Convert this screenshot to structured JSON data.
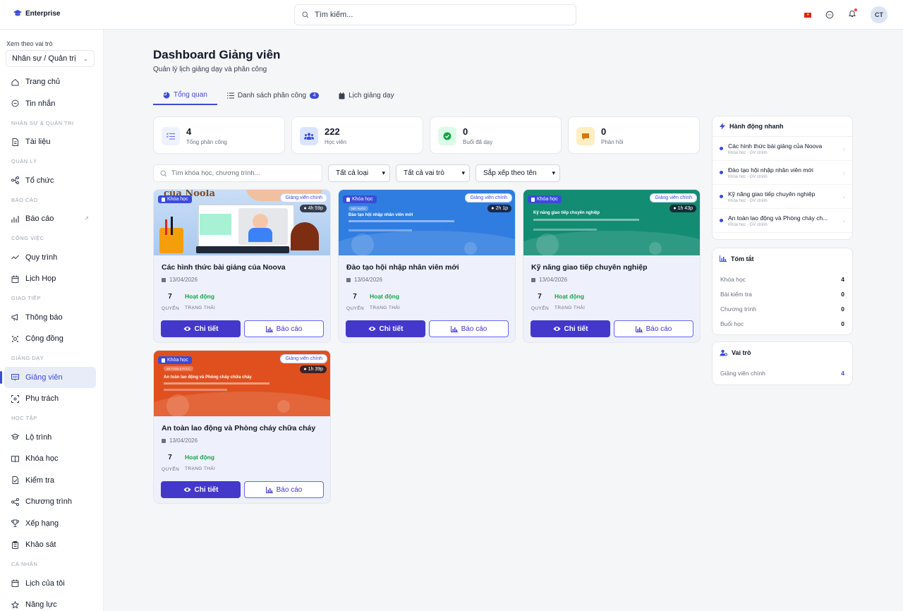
{
  "app": {
    "name": "Enterprise"
  },
  "header": {
    "search_placeholder": "Tìm kiếm...",
    "avatar": "CT"
  },
  "sidebar": {
    "view_as_label": "Xem theo vai trò",
    "role_value": "Nhân sự / Quản trị",
    "items": [
      {
        "type": "item",
        "label": "Trang chủ",
        "icon": "home-icon"
      },
      {
        "type": "item",
        "label": "Tin nhắn",
        "icon": "chat-icon"
      },
      {
        "type": "section",
        "label": "NHÂN SỰ & QUẢN TRỊ"
      },
      {
        "type": "item",
        "label": "Tài liệu",
        "icon": "document-icon"
      },
      {
        "type": "section",
        "label": "QUẢN LÝ"
      },
      {
        "type": "item",
        "label": "Tổ chức",
        "icon": "org-icon"
      },
      {
        "type": "section",
        "label": "BÁO CÁO"
      },
      {
        "type": "item",
        "label": "Báo cáo",
        "icon": "chart-icon",
        "external": true
      },
      {
        "type": "section",
        "label": "CÔNG VIỆC"
      },
      {
        "type": "item",
        "label": "Quy trình",
        "icon": "workflow-icon"
      },
      {
        "type": "item",
        "label": "Lịch Họp",
        "icon": "calendar-icon"
      },
      {
        "type": "section",
        "label": "GIAO TIẾP"
      },
      {
        "type": "item",
        "label": "Thông báo",
        "icon": "megaphone-icon"
      },
      {
        "type": "item",
        "label": "Cộng đồng",
        "icon": "community-icon"
      },
      {
        "type": "section",
        "label": "GIẢNG DẠY"
      },
      {
        "type": "item",
        "label": "Giảng viên",
        "icon": "teacher-icon",
        "active": true
      },
      {
        "type": "item",
        "label": "Phụ trách",
        "icon": "focus-icon"
      },
      {
        "type": "section",
        "label": "HỌC TẬP"
      },
      {
        "type": "item",
        "label": "Lộ trình",
        "icon": "graduation-icon"
      },
      {
        "type": "item",
        "label": "Khóa học",
        "icon": "book-icon"
      },
      {
        "type": "item",
        "label": "Kiểm tra",
        "icon": "test-icon"
      },
      {
        "type": "item",
        "label": "Chương trình",
        "icon": "program-icon"
      },
      {
        "type": "item",
        "label": "Xếp hạng",
        "icon": "trophy-icon"
      },
      {
        "type": "item",
        "label": "Khảo sát",
        "icon": "survey-icon"
      },
      {
        "type": "section",
        "label": "CÁ NHÂN"
      },
      {
        "type": "item",
        "label": "Lịch của tôi",
        "icon": "calendar-icon"
      },
      {
        "type": "item",
        "label": "Năng lực",
        "icon": "star-icon"
      }
    ]
  },
  "page": {
    "title": "Dashboard Giảng viên",
    "subtitle": "Quản lý lịch giảng dạy và phân công"
  },
  "tabs": [
    {
      "label": "Tổng quan",
      "active": true
    },
    {
      "label": "Danh sách phân công",
      "badge": "4"
    },
    {
      "label": "Lịch giảng dạy"
    }
  ],
  "stats": [
    {
      "value": "4",
      "label": "Tổng phân công",
      "color": "#6366f1",
      "bg": "#eef2ff"
    },
    {
      "value": "222",
      "label": "Học viên",
      "color": "#3b4bd8",
      "bg": "#e0e7ff"
    },
    {
      "value": "0",
      "label": "Buổi đã dạy",
      "color": "#16a34a",
      "bg": "#dcfce7"
    },
    {
      "value": "0",
      "label": "Phản hồi",
      "color": "#d97706",
      "bg": "#fef3c7"
    }
  ],
  "filters": {
    "search_placeholder": "Tìm khóa học, chương trình...",
    "type": "Tất cả loại",
    "role": "Tất cả vai trò",
    "sort": "Sắp xếp theo tên"
  },
  "cards": [
    {
      "title": "Các hình thức bài giảng của Noova",
      "date": "13/04/2026",
      "count": "7",
      "count_label": "QUYỂN",
      "status": "Hoạt động",
      "status_label": "TRẠNG THÁI",
      "tag": "Khóa học",
      "role": "Giảng viên chính",
      "duration": "4h 59p",
      "theme": "#9bc4f0",
      "thumb_text": "của Noola"
    },
    {
      "title": "Đào tạo hội nhập nhân viên mới",
      "date": "13/04/2026",
      "count": "7",
      "count_label": "QUYỂN",
      "status": "Hoạt động",
      "status_label": "TRẠNG THÁI",
      "tag": "Khóa học",
      "role": "Giảng viên chính",
      "duration": "2h 1p",
      "theme": "#2f7de1",
      "thumb_text": "Đào tạo hội nhập nhân viên mới"
    },
    {
      "title": "Kỹ năng giao tiếp chuyên nghiệp",
      "date": "13/04/2026",
      "count": "7",
      "count_label": "QUYỂN",
      "status": "Hoạt động",
      "status_label": "TRẠNG THÁI",
      "tag": "Khóa học",
      "role": "Giảng viên chính",
      "duration": "1h 43p",
      "theme": "#138c74",
      "thumb_text": "Kỹ năng giao tiếp chuyên nghiệp"
    },
    {
      "title": "An toàn lao động và Phòng cháy chữa cháy",
      "date": "13/04/2026",
      "count": "7",
      "count_label": "QUYỂN",
      "status": "Hoạt động",
      "status_label": "TRẠNG THÁI",
      "tag": "Khóa học",
      "role": "Giảng viên chính",
      "duration": "1h 39p",
      "theme": "#e0501f",
      "thumb_text": "An toàn lao động và Phòng cháy chữa cháy"
    }
  ],
  "card_buttons": {
    "detail": "Chi tiết",
    "report": "Báo cáo"
  },
  "quick_actions": {
    "title": "Hành động nhanh",
    "items": [
      {
        "title": "Các hình thức bài giảng của Noova",
        "sub": "Khóa học · GV chính"
      },
      {
        "title": "Đào tạo hội nhập nhân viên mới",
        "sub": "Khóa học · GV chính"
      },
      {
        "title": "Kỹ năng giao tiếp chuyên nghiệp",
        "sub": "Khóa học · GV chính"
      },
      {
        "title": "An toàn lao động và Phòng cháy ch...",
        "sub": "Khóa học · GV chính"
      }
    ]
  },
  "summary": {
    "title": "Tóm tắt",
    "rows": [
      {
        "label": "Khóa học",
        "value": "4"
      },
      {
        "label": "Bài kiểm tra",
        "value": "0"
      },
      {
        "label": "Chương trình",
        "value": "0"
      },
      {
        "label": "Buổi học",
        "value": "0"
      }
    ]
  },
  "roles": {
    "title": "Vai trò",
    "rows": [
      {
        "label": "Giảng viên chính",
        "value": "4"
      }
    ]
  }
}
